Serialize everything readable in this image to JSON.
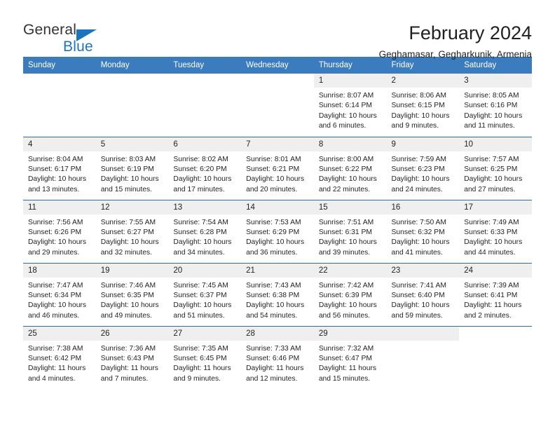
{
  "brand": {
    "word1": "General",
    "word2": "Blue",
    "triangle_color": "#1b75bb"
  },
  "header": {
    "title": "February 2024",
    "subtitle": "Geghamasar, Gegharkunik, Armenia"
  },
  "calendar": {
    "header_color": "#3a7cbe",
    "daynum_band_color": "#efefef",
    "row_divider_color": "#2e6da4",
    "weekdays": [
      "Sunday",
      "Monday",
      "Tuesday",
      "Wednesday",
      "Thursday",
      "Friday",
      "Saturday"
    ],
    "weeks": [
      [
        {
          "day": "",
          "blank": true,
          "empty": true
        },
        {
          "day": "",
          "blank": true,
          "empty": true
        },
        {
          "day": "",
          "blank": true,
          "empty": true
        },
        {
          "day": "",
          "blank": true,
          "empty": true
        },
        {
          "day": "1",
          "sunrise": "Sunrise: 8:07 AM",
          "sunset": "Sunset: 6:14 PM",
          "daylight1": "Daylight: 10 hours",
          "daylight2": "and 6 minutes."
        },
        {
          "day": "2",
          "sunrise": "Sunrise: 8:06 AM",
          "sunset": "Sunset: 6:15 PM",
          "daylight1": "Daylight: 10 hours",
          "daylight2": "and 9 minutes."
        },
        {
          "day": "3",
          "sunrise": "Sunrise: 8:05 AM",
          "sunset": "Sunset: 6:16 PM",
          "daylight1": "Daylight: 10 hours",
          "daylight2": "and 11 minutes."
        }
      ],
      [
        {
          "day": "4",
          "sunrise": "Sunrise: 8:04 AM",
          "sunset": "Sunset: 6:17 PM",
          "daylight1": "Daylight: 10 hours",
          "daylight2": "and 13 minutes."
        },
        {
          "day": "5",
          "sunrise": "Sunrise: 8:03 AM",
          "sunset": "Sunset: 6:19 PM",
          "daylight1": "Daylight: 10 hours",
          "daylight2": "and 15 minutes."
        },
        {
          "day": "6",
          "sunrise": "Sunrise: 8:02 AM",
          "sunset": "Sunset: 6:20 PM",
          "daylight1": "Daylight: 10 hours",
          "daylight2": "and 17 minutes."
        },
        {
          "day": "7",
          "sunrise": "Sunrise: 8:01 AM",
          "sunset": "Sunset: 6:21 PM",
          "daylight1": "Daylight: 10 hours",
          "daylight2": "and 20 minutes."
        },
        {
          "day": "8",
          "sunrise": "Sunrise: 8:00 AM",
          "sunset": "Sunset: 6:22 PM",
          "daylight1": "Daylight: 10 hours",
          "daylight2": "and 22 minutes."
        },
        {
          "day": "9",
          "sunrise": "Sunrise: 7:59 AM",
          "sunset": "Sunset: 6:23 PM",
          "daylight1": "Daylight: 10 hours",
          "daylight2": "and 24 minutes."
        },
        {
          "day": "10",
          "sunrise": "Sunrise: 7:57 AM",
          "sunset": "Sunset: 6:25 PM",
          "daylight1": "Daylight: 10 hours",
          "daylight2": "and 27 minutes."
        }
      ],
      [
        {
          "day": "11",
          "sunrise": "Sunrise: 7:56 AM",
          "sunset": "Sunset: 6:26 PM",
          "daylight1": "Daylight: 10 hours",
          "daylight2": "and 29 minutes."
        },
        {
          "day": "12",
          "sunrise": "Sunrise: 7:55 AM",
          "sunset": "Sunset: 6:27 PM",
          "daylight1": "Daylight: 10 hours",
          "daylight2": "and 32 minutes."
        },
        {
          "day": "13",
          "sunrise": "Sunrise: 7:54 AM",
          "sunset": "Sunset: 6:28 PM",
          "daylight1": "Daylight: 10 hours",
          "daylight2": "and 34 minutes."
        },
        {
          "day": "14",
          "sunrise": "Sunrise: 7:53 AM",
          "sunset": "Sunset: 6:29 PM",
          "daylight1": "Daylight: 10 hours",
          "daylight2": "and 36 minutes."
        },
        {
          "day": "15",
          "sunrise": "Sunrise: 7:51 AM",
          "sunset": "Sunset: 6:31 PM",
          "daylight1": "Daylight: 10 hours",
          "daylight2": "and 39 minutes."
        },
        {
          "day": "16",
          "sunrise": "Sunrise: 7:50 AM",
          "sunset": "Sunset: 6:32 PM",
          "daylight1": "Daylight: 10 hours",
          "daylight2": "and 41 minutes."
        },
        {
          "day": "17",
          "sunrise": "Sunrise: 7:49 AM",
          "sunset": "Sunset: 6:33 PM",
          "daylight1": "Daylight: 10 hours",
          "daylight2": "and 44 minutes."
        }
      ],
      [
        {
          "day": "18",
          "sunrise": "Sunrise: 7:47 AM",
          "sunset": "Sunset: 6:34 PM",
          "daylight1": "Daylight: 10 hours",
          "daylight2": "and 46 minutes."
        },
        {
          "day": "19",
          "sunrise": "Sunrise: 7:46 AM",
          "sunset": "Sunset: 6:35 PM",
          "daylight1": "Daylight: 10 hours",
          "daylight2": "and 49 minutes."
        },
        {
          "day": "20",
          "sunrise": "Sunrise: 7:45 AM",
          "sunset": "Sunset: 6:37 PM",
          "daylight1": "Daylight: 10 hours",
          "daylight2": "and 51 minutes."
        },
        {
          "day": "21",
          "sunrise": "Sunrise: 7:43 AM",
          "sunset": "Sunset: 6:38 PM",
          "daylight1": "Daylight: 10 hours",
          "daylight2": "and 54 minutes."
        },
        {
          "day": "22",
          "sunrise": "Sunrise: 7:42 AM",
          "sunset": "Sunset: 6:39 PM",
          "daylight1": "Daylight: 10 hours",
          "daylight2": "and 56 minutes."
        },
        {
          "day": "23",
          "sunrise": "Sunrise: 7:41 AM",
          "sunset": "Sunset: 6:40 PM",
          "daylight1": "Daylight: 10 hours",
          "daylight2": "and 59 minutes."
        },
        {
          "day": "24",
          "sunrise": "Sunrise: 7:39 AM",
          "sunset": "Sunset: 6:41 PM",
          "daylight1": "Daylight: 11 hours",
          "daylight2": "and 2 minutes."
        }
      ],
      [
        {
          "day": "25",
          "sunrise": "Sunrise: 7:38 AM",
          "sunset": "Sunset: 6:42 PM",
          "daylight1": "Daylight: 11 hours",
          "daylight2": "and 4 minutes."
        },
        {
          "day": "26",
          "sunrise": "Sunrise: 7:36 AM",
          "sunset": "Sunset: 6:43 PM",
          "daylight1": "Daylight: 11 hours",
          "daylight2": "and 7 minutes."
        },
        {
          "day": "27",
          "sunrise": "Sunrise: 7:35 AM",
          "sunset": "Sunset: 6:45 PM",
          "daylight1": "Daylight: 11 hours",
          "daylight2": "and 9 minutes."
        },
        {
          "day": "28",
          "sunrise": "Sunrise: 7:33 AM",
          "sunset": "Sunset: 6:46 PM",
          "daylight1": "Daylight: 11 hours",
          "daylight2": "and 12 minutes."
        },
        {
          "day": "29",
          "sunrise": "Sunrise: 7:32 AM",
          "sunset": "Sunset: 6:47 PM",
          "daylight1": "Daylight: 11 hours",
          "daylight2": "and 15 minutes."
        },
        {
          "day": "",
          "blank": false,
          "empty": true
        },
        {
          "day": "",
          "blank": true,
          "empty": true
        }
      ]
    ]
  }
}
